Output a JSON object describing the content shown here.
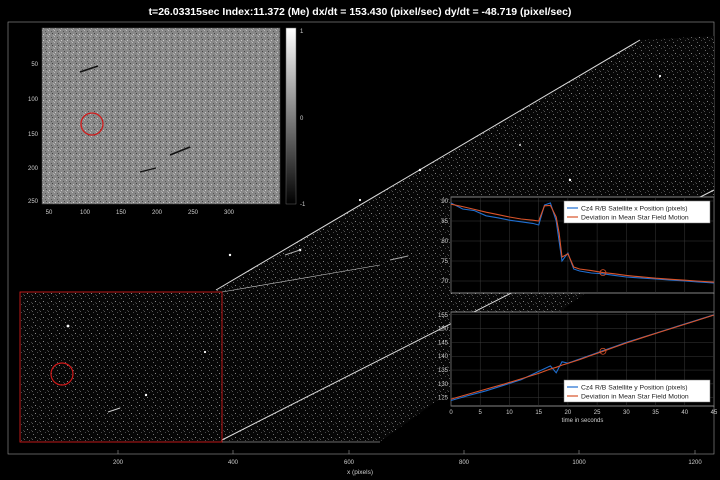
{
  "header": {
    "title": "t=26.03315sec  Index:11.372 (Me)    dx/dt = 153.430 (pixel/sec)  dy/dt = -48.719 (pixel/sec)"
  },
  "main_image": {
    "xlabel": "x (pixels)",
    "xticks": [
      "200",
      "400",
      "600",
      "800",
      "1000",
      "1200"
    ]
  },
  "inset_image": {
    "xticks": [
      "50",
      "100",
      "150",
      "200",
      "250",
      "300"
    ],
    "yticks": [
      "50",
      "100",
      "150",
      "200",
      "250"
    ],
    "colorbar_ticks": [
      "1",
      "0",
      "-1"
    ]
  },
  "colors": {
    "series_x_y": "#1f6fd1",
    "series_deviation": "#d9532a",
    "highlight_box": "#d11a1a"
  },
  "chart_data": [
    {
      "type": "line",
      "legend": [
        "Cz4 R/B Satellite x Position (pixels)",
        "Deviation in Mean Star Field Motion"
      ],
      "legend_position": "top-right",
      "xlim": [
        0,
        45
      ],
      "ylim": [
        67,
        91
      ],
      "yticks": [
        "70",
        "75",
        "80",
        "85",
        "90"
      ],
      "grid": true,
      "series": [
        {
          "name": "Cz4 R/B Satellite x Position (pixels)",
          "x": [
            0,
            2,
            4,
            6,
            8,
            10,
            12,
            14,
            15,
            16,
            17,
            18,
            18.5,
            19,
            20,
            21,
            22,
            24,
            26,
            28,
            30,
            32,
            35,
            38,
            40,
            42,
            45
          ],
          "y": [
            89.5,
            88,
            87.6,
            86.3,
            85.8,
            85.2,
            84.8,
            84.4,
            84,
            89,
            89.5,
            85,
            80,
            75,
            77,
            73,
            72.5,
            72,
            71.8,
            71.4,
            71,
            70.8,
            70.5,
            70.2,
            70,
            69.8,
            69.5
          ]
        },
        {
          "name": "Deviation in Mean Star Field Motion",
          "x": [
            0,
            2,
            4,
            6,
            8,
            10,
            12,
            14,
            15,
            16,
            17,
            18,
            18.5,
            19,
            20,
            21,
            22,
            24,
            26,
            28,
            30,
            32,
            35,
            38,
            40,
            42,
            45
          ],
          "y": [
            89.2,
            88.6,
            87.9,
            87.2,
            86.6,
            86,
            85.5,
            85.2,
            85,
            88.8,
            88.9,
            86,
            82,
            76,
            76.8,
            73.5,
            73,
            72.6,
            72.1,
            71.8,
            71.4,
            71.1,
            70.7,
            70.4,
            70.2,
            70,
            69.7
          ]
        }
      ]
    },
    {
      "type": "line",
      "legend": [
        "Cz4 R/B Satellite y Position (pixels)",
        "Deviation in Mean Star Field Motion"
      ],
      "legend_position": "bottom-right",
      "xlabel": "time in seconds",
      "xlim": [
        0,
        45
      ],
      "ylim": [
        122,
        156
      ],
      "xticks": [
        "0",
        "5",
        "10",
        "15",
        "20",
        "25",
        "30",
        "35",
        "40",
        "45"
      ],
      "yticks": [
        "125",
        "130",
        "135",
        "140",
        "145",
        "150",
        "155"
      ],
      "grid": true,
      "series": [
        {
          "name": "Cz4 R/B Satellite y Position (pixels)",
          "x": [
            0,
            3,
            6,
            9,
            12,
            15,
            17,
            18,
            19,
            20,
            22,
            24,
            26,
            28,
            30,
            33,
            36,
            39,
            42,
            45
          ],
          "y": [
            124,
            125.8,
            127.5,
            129.5,
            131.5,
            134.5,
            136.5,
            134,
            138,
            137.5,
            139,
            140.5,
            142,
            143.5,
            145,
            147,
            149,
            151,
            153,
            155
          ]
        },
        {
          "name": "Deviation in Mean Star Field Motion",
          "x": [
            0,
            3,
            6,
            9,
            12,
            15,
            17,
            18,
            19,
            20,
            22,
            24,
            26,
            28,
            30,
            33,
            36,
            39,
            42,
            45
          ],
          "y": [
            124.5,
            126.3,
            128.1,
            129.9,
            131.8,
            133.8,
            135.4,
            136,
            136.8,
            137.4,
            138.8,
            140.3,
            141.8,
            143.3,
            144.8,
            146.9,
            148.9,
            150.9,
            152.9,
            154.9
          ]
        }
      ]
    }
  ]
}
